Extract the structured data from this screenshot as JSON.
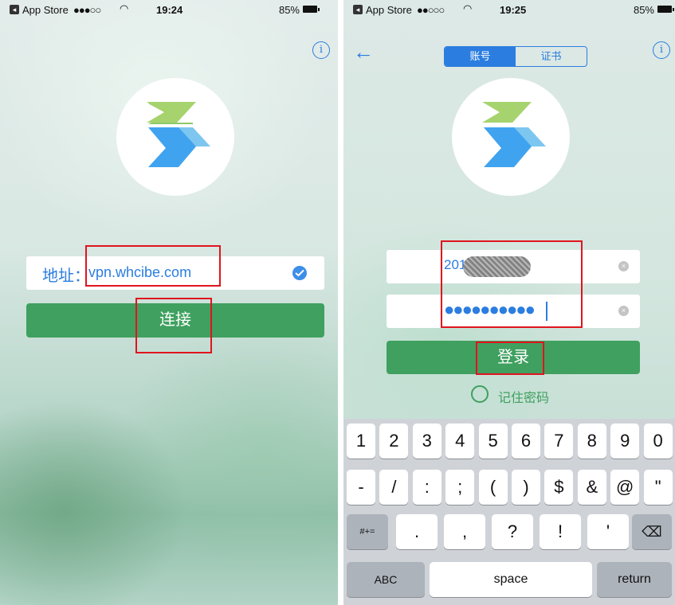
{
  "left": {
    "status": {
      "carrier": "App Store",
      "signal": "●●●○○",
      "time": "19:24",
      "battery": "85%"
    },
    "info_icon": "i",
    "address": {
      "label": "地址：",
      "value": "vpn.whcibe.com"
    },
    "connect_label": "连接"
  },
  "right": {
    "status": {
      "carrier": "App Store",
      "signal": "●●○○○",
      "time": "19:25",
      "battery": "85%"
    },
    "back_icon": "←",
    "info_icon": "i",
    "tabs": [
      "账号",
      "证书"
    ],
    "username_visible": "201",
    "password_dots": "●●●●●●●●●●",
    "login_label": "登录",
    "remember_label": "记住密码",
    "keyboard": {
      "row1": [
        "1",
        "2",
        "3",
        "4",
        "5",
        "6",
        "7",
        "8",
        "9",
        "0"
      ],
      "row2": [
        "-",
        "/",
        ":",
        ";",
        "(",
        ")",
        "$",
        "&",
        "@",
        "\""
      ],
      "row3_left": "#+=",
      "row3": [
        ".",
        ",",
        "?",
        "!",
        "'"
      ],
      "row3_right": "⌫",
      "abc": "ABC",
      "space": "space",
      "return": "return"
    }
  },
  "colors": {
    "accent": "#2b7de0",
    "green": "#3fa05f",
    "highlight": "#e0141e"
  }
}
